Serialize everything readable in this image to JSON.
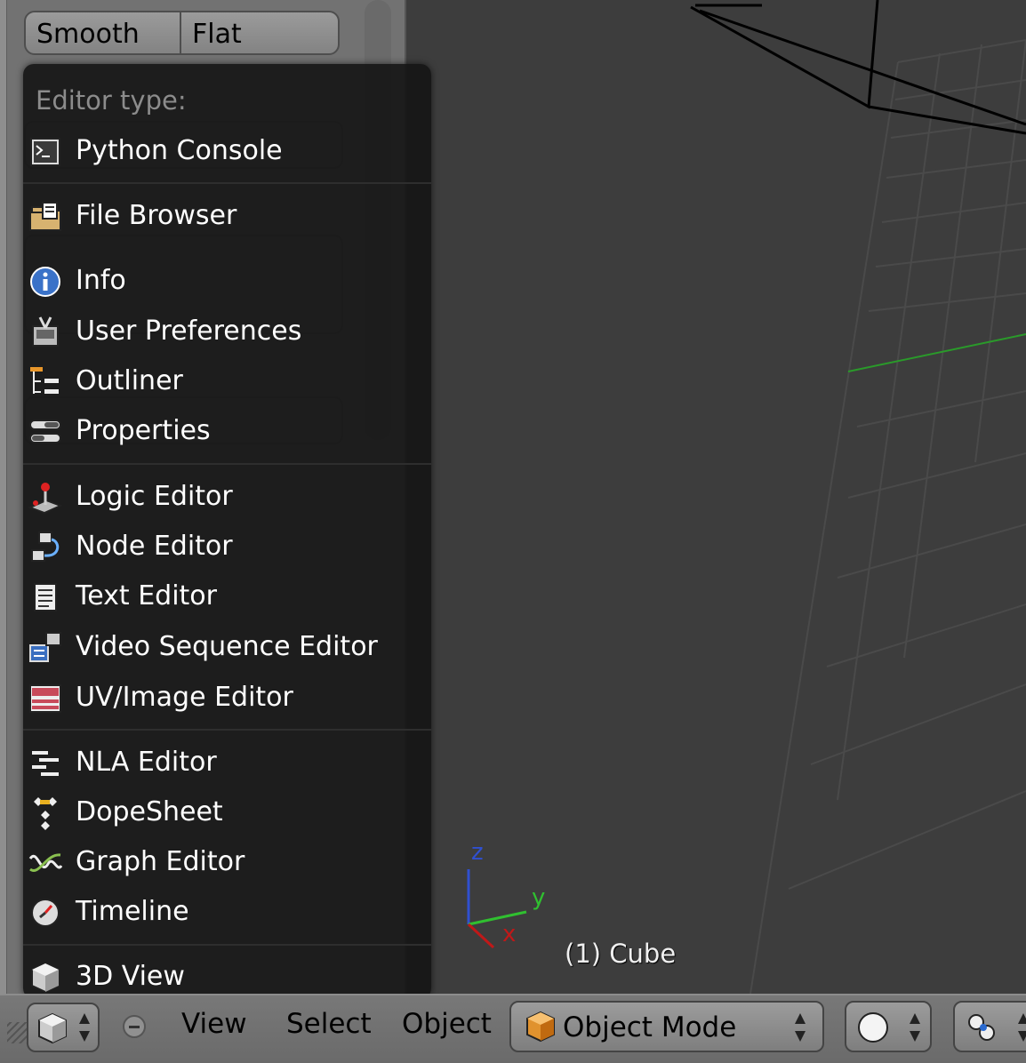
{
  "shelf": {
    "shade_buttons": [
      "Smooth",
      "Flat"
    ]
  },
  "editor_menu": {
    "title": "Editor type:",
    "groups": [
      {
        "items": [
          {
            "label": "Python Console",
            "icon": "python-console-icon"
          }
        ]
      },
      {
        "items": [
          {
            "label": "File Browser",
            "icon": "file-browser-icon"
          },
          {
            "label": "Info",
            "icon": "info-icon"
          },
          {
            "label": "User Preferences",
            "icon": "user-preferences-icon"
          },
          {
            "label": "Outliner",
            "icon": "outliner-icon"
          },
          {
            "label": "Properties",
            "icon": "properties-icon"
          }
        ]
      },
      {
        "items": [
          {
            "label": "Logic Editor",
            "icon": "logic-editor-icon"
          },
          {
            "label": "Node Editor",
            "icon": "node-editor-icon"
          },
          {
            "label": "Text Editor",
            "icon": "text-editor-icon"
          },
          {
            "label": "Video Sequence Editor",
            "icon": "video-sequence-editor-icon"
          },
          {
            "label": "UV/Image Editor",
            "icon": "uv-image-editor-icon"
          }
        ]
      },
      {
        "items": [
          {
            "label": "NLA Editor",
            "icon": "nla-editor-icon"
          },
          {
            "label": "DopeSheet",
            "icon": "dopesheet-icon"
          },
          {
            "label": "Graph Editor",
            "icon": "graph-editor-icon"
          },
          {
            "label": "Timeline",
            "icon": "timeline-icon"
          }
        ]
      },
      {
        "items": [
          {
            "label": "3D View",
            "icon": "3d-view-icon"
          }
        ]
      }
    ]
  },
  "viewport": {
    "object_label": "(1) Cube",
    "axes": {
      "x": "x",
      "y": "y",
      "z": "z"
    },
    "colors": {
      "x": "#c01818",
      "y": "#30c030",
      "z": "#3050d0",
      "grid": "#4a4a4a",
      "axis_line": "#2a9a2a"
    }
  },
  "header": {
    "menus": [
      "View",
      "Select",
      "Object"
    ],
    "mode": "Object Mode",
    "mode_icon": "cube-object-icon",
    "shading_icon": "solid-sphere-icon",
    "pivot_icon": "pivot-point-icon",
    "editor_icon": "3d-view-icon"
  }
}
